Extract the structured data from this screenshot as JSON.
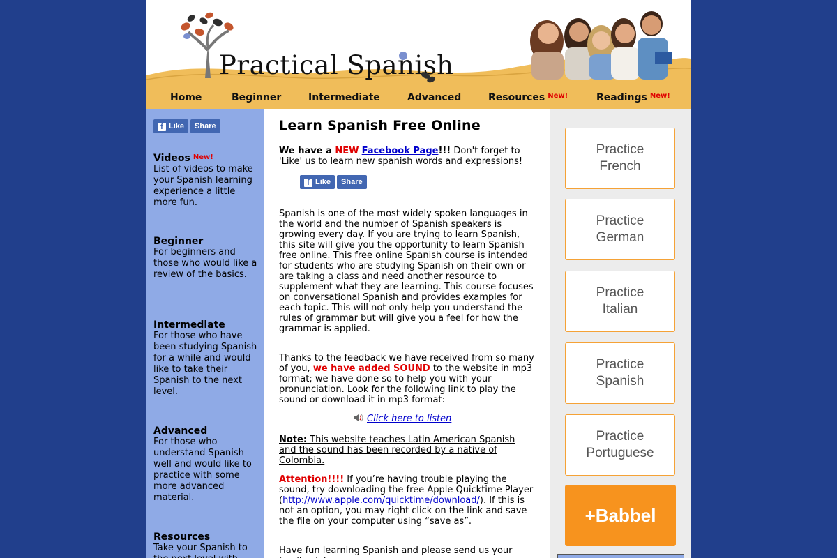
{
  "header": {
    "logo_text": "Practical Spanish",
    "nav": [
      {
        "label": "Home",
        "new": ""
      },
      {
        "label": "Beginner",
        "new": ""
      },
      {
        "label": "Intermediate",
        "new": ""
      },
      {
        "label": "Advanced",
        "new": ""
      },
      {
        "label": "Resources",
        "new": "New!"
      },
      {
        "label": "Readings",
        "new": "New!"
      }
    ]
  },
  "social": {
    "like_label": "Like",
    "share_label": "Share"
  },
  "sidebar": {
    "sections": [
      {
        "title": "Videos",
        "new": "New!",
        "desc": "List of videos to make your Spanish learning experience a little more fun."
      },
      {
        "title": "Beginner",
        "new": "",
        "desc": "For beginners and those who would like a review of the basics."
      },
      {
        "title": "Intermediate",
        "new": "",
        "desc": "For those who have been studying Spanish for a while and would like to take their Spanish to the next level."
      },
      {
        "title": "Advanced",
        "new": "",
        "desc": "For those who understand Spanish well and would like to practice with some more advanced material."
      },
      {
        "title": "Resources",
        "new": "",
        "desc": "Take your Spanish to the next level with"
      }
    ]
  },
  "main": {
    "title": "Learn Spanish Free Online",
    "fb_intro": {
      "we_have": "We have a ",
      "new_word": "NEW",
      "fb_link": "Facebook Page",
      "exclaim": "!!!",
      "rest": " Don't forget to 'Like' us to learn new spanish words and expressions!"
    },
    "para1": "Spanish is one of the most widely spoken languages in the world and the number of Spanish speakers is growing every day. If you are trying to learn Spanish, this site will give you the opportunity to learn Spanish free online. This free online Spanish course is intended for students who are studying Spanish on their own or are taking a class and need another resource to supplement what they are learning. This course focuses on conversational Spanish and provides examples for each topic. This will not only help you understand the rules of grammar but will give you a feel for how the grammar is applied.",
    "para2": {
      "a": "Thanks to the feedback we have received from so many of you, ",
      "highlight": "we have added SOUND",
      "b": " to the website in mp3 format; we have done so to help you with your pronunciation. Look for the following link to play the sound or download it in mp3 format:"
    },
    "listen_link": "Click here to listen",
    "note": {
      "label": "Note:",
      "text": " This website teaches Latin American Spanish and the sound has been recorded by a native of Colombia."
    },
    "attention": {
      "label": "Attention!!!!",
      "a": " If you’re having trouble playing the sound, try downloading the free Apple Quicktime Player (",
      "link": "http://www.apple.com/quicktime/download/",
      "b": "). If this is not an option, you may right click on the link and save the file on your computer using “save as”."
    },
    "closing": "Have fun learning Spanish and please send us your feedback to"
  },
  "ads": [
    {
      "line1": "Practice",
      "line2": "French"
    },
    {
      "line1": "Practice",
      "line2": "German"
    },
    {
      "line1": "Practice",
      "line2": "Italian"
    },
    {
      "line1": "Practice",
      "line2": "Spanish"
    },
    {
      "line1": "Practice",
      "line2": "Portuguese"
    }
  ],
  "babbel": "+Babbel",
  "colors": {
    "background": "#213f8c",
    "nav_bar": "#f0bd5a",
    "sidebar": "#8faae6",
    "new_badge": "#e00000",
    "ad_border": "#f5a236",
    "babbel": "#f7931e",
    "facebook": "#4267b2"
  }
}
